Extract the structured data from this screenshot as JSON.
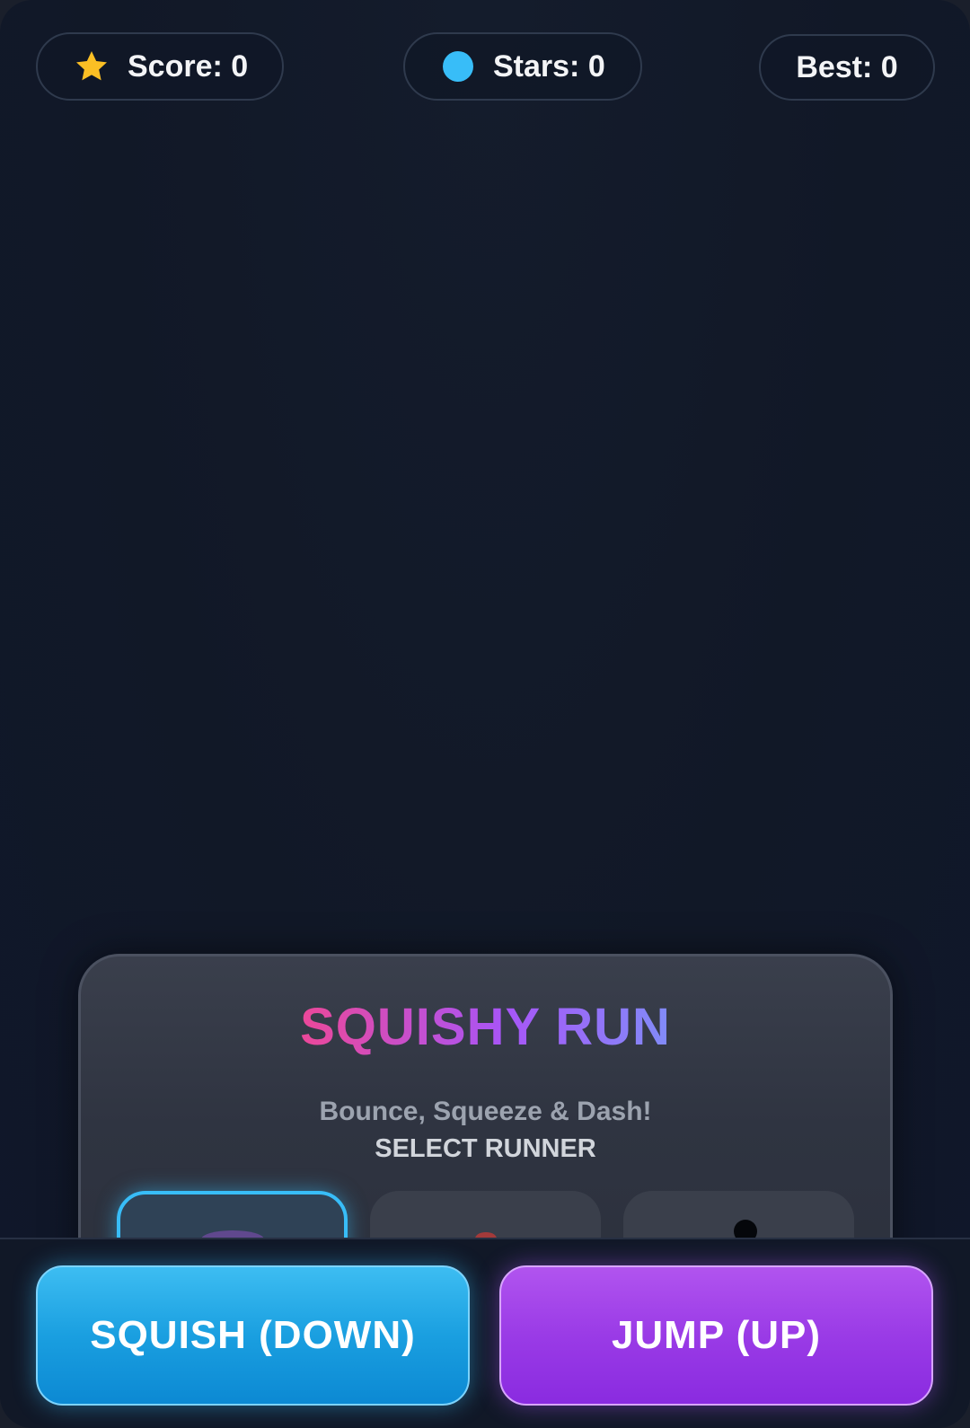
{
  "hud": {
    "score_label": "Score: 0",
    "stars_label": "Stars: 0",
    "best_label": "Best: 0",
    "score_icon": "star-icon",
    "stars_icon": "blue-dot-icon"
  },
  "menu": {
    "title": "SQUISHY RUN",
    "subtitle": "Bounce, Squeeze & Dash!",
    "select_label": "SELECT RUNNER",
    "runners_selected_index": 0
  },
  "controls": {
    "squish_label": "SQUISH (DOWN)",
    "jump_label": "JUMP (UP)"
  },
  "colors": {
    "background": "#111827",
    "accent_blue": "#38bdf8",
    "accent_purple": "#a855f7",
    "star_gold": "#fbbf24",
    "title_pink": "#ec4899"
  }
}
